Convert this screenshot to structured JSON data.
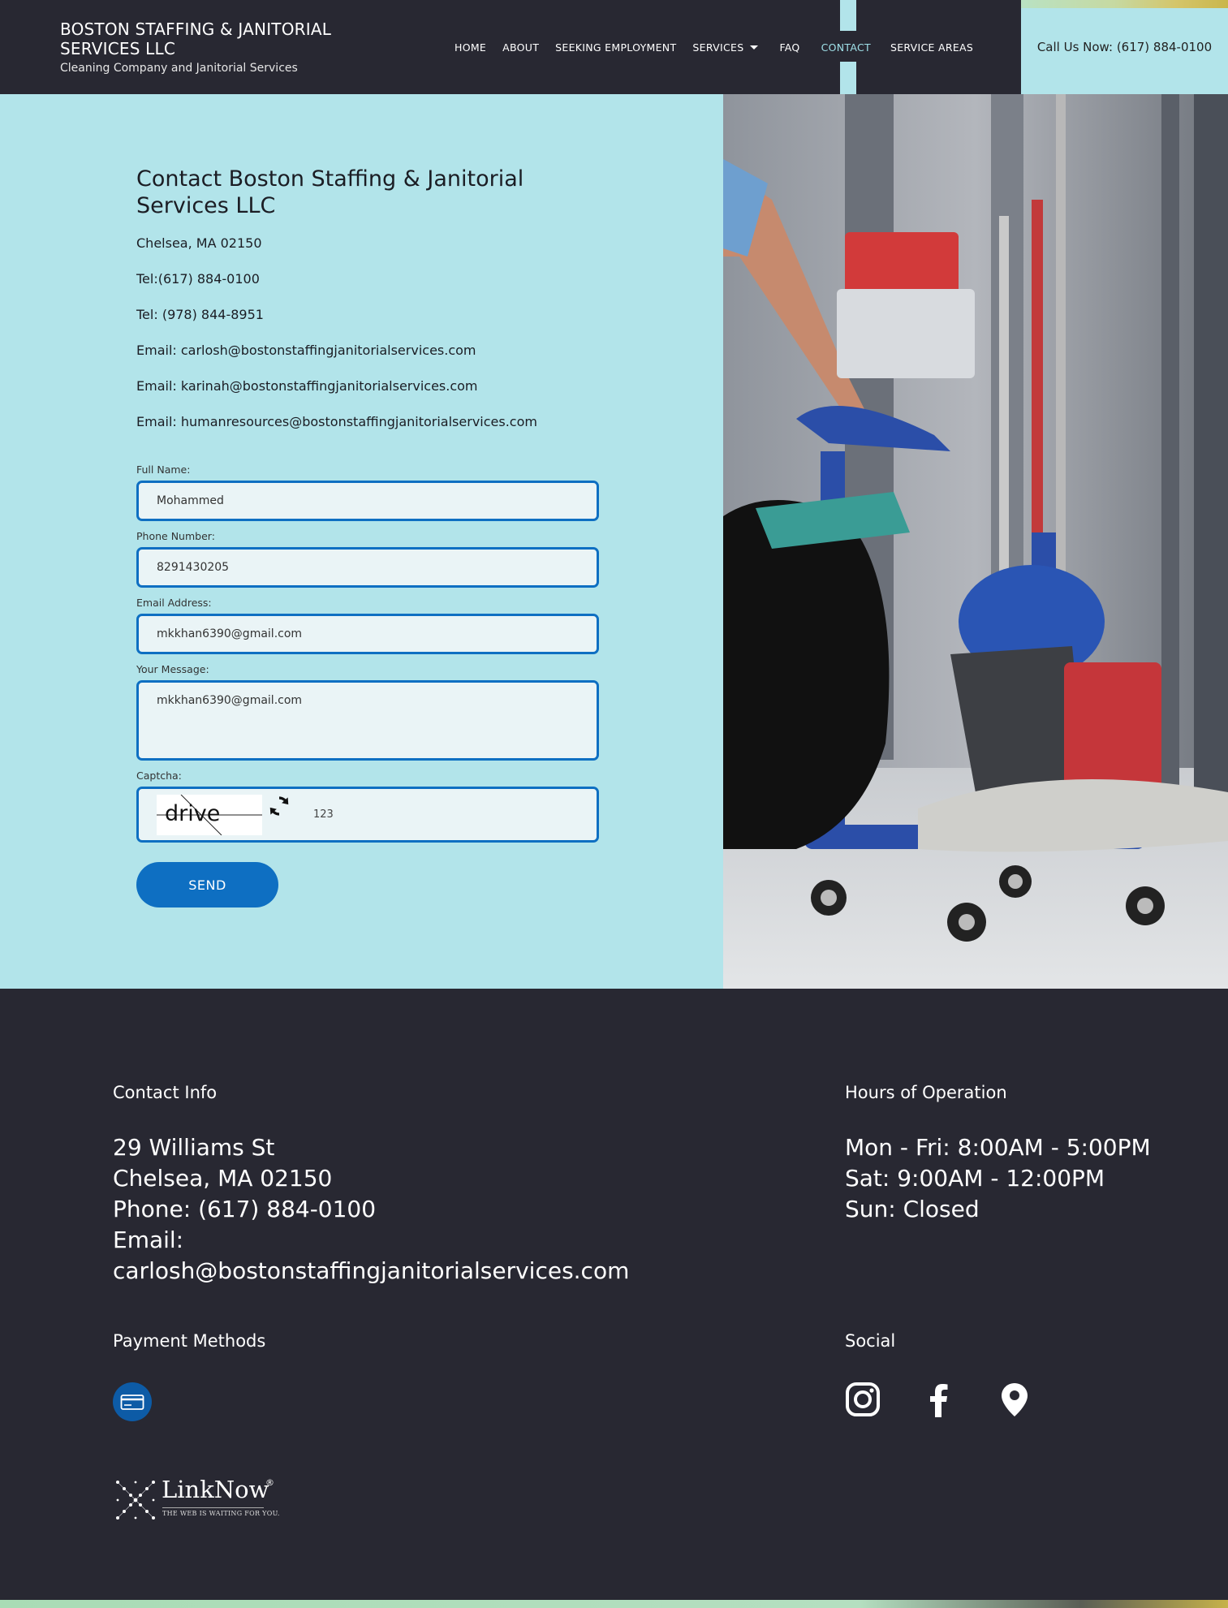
{
  "header": {
    "brand_name": "BOSTON STAFFING & JANITORIAL SERVICES LLC",
    "brand_tagline": "Cleaning Company and Janitorial Services",
    "nav": [
      {
        "label": "HOME"
      },
      {
        "label": "ABOUT"
      },
      {
        "label": "SEEKING EMPLOYMENT"
      },
      {
        "label": "SERVICES"
      },
      {
        "label": "FAQ"
      },
      {
        "label": "CONTACT"
      },
      {
        "label": "SERVICE AREAS"
      }
    ],
    "call_now": "Call Us Now: (617) 884-0100"
  },
  "contact": {
    "title": "Contact Boston Staffing & Janitorial Services LLC",
    "address": "Chelsea, MA 02150",
    "tel1": "Tel:(617) 884-0100",
    "tel2": "Tel: (978) 844-8951",
    "email1": "Email: carlosh@bostonstaffingjanitorialservices.com",
    "email2": "Email: karinah@bostonstaffingjanitorialservices.com",
    "email3": "Email: humanresources@bostonstaffingjanitorialservices.com"
  },
  "form": {
    "full_name_label": "Full Name:",
    "full_name_value": "Mohammed",
    "phone_label": "Phone Number:",
    "phone_value": "8291430205",
    "email_label": "Email Address:",
    "email_value": "mkkhan6390@gmail.com",
    "message_label": "Your Message:",
    "message_value": "mkkhan6390@gmail.com",
    "captcha_label": "Captcha:",
    "captcha_word": "drive",
    "captcha_value": "123",
    "send_label": "SEND"
  },
  "footer": {
    "contact_heading": "Contact Info",
    "contact_lines": [
      "29 Williams St",
      "Chelsea, MA 02150",
      "Phone: (617) 884-0100",
      "Email:",
      "carlosh@bostonstaffingjanitorialservices.com"
    ],
    "hours_heading": "Hours of Operation",
    "hours_lines": [
      "Mon - Fri: 8:00AM - 5:00PM",
      "Sat: 9:00AM - 12:00PM",
      "Sun: Closed"
    ],
    "payment_heading": "Payment Methods",
    "social_heading": "Social",
    "linknow_name": "LinkNow",
    "linknow_mark": "®",
    "linknow_tagline": "THE WEB IS WAITING FOR YOU."
  },
  "icons": {
    "payment": "credit-card-icon",
    "social": [
      "instagram-icon",
      "facebook-icon",
      "map-pin-icon"
    ]
  },
  "colors": {
    "dark": "#282832",
    "light_blue": "#b2e4ea",
    "accent_blue": "#0e6fc2"
  }
}
